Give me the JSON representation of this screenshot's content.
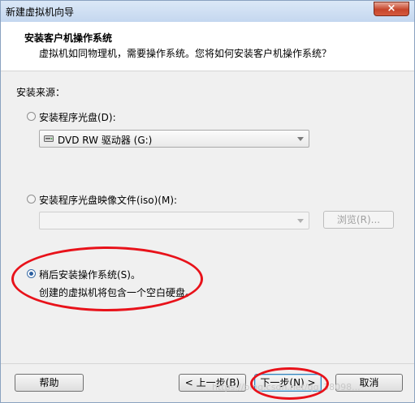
{
  "window": {
    "title": "新建虚拟机向导",
    "close_glyph": "×"
  },
  "header": {
    "title": "安装客户机操作系统",
    "subtitle": "虚拟机如同物理机，需要操作系统。您将如何安装客户机操作系统？"
  },
  "source_label": "安装来源：",
  "options": [
    {
      "label": "安装程序光盘(D):",
      "selected": false
    },
    {
      "label": "安装程序光盘映像文件(iso)(M):",
      "selected": false
    },
    {
      "label": "稍后安装操作系统(S)。",
      "selected": true
    }
  ],
  "drive_select": {
    "value": "DVD RW 驱动器 (G:)",
    "icon": "dvd-drive-icon"
  },
  "iso_select": {
    "value": ""
  },
  "browse_button": "浏览(R)...",
  "later_note": "创建的虚拟机将包含一个空白硬盘。",
  "buttons": {
    "help": "帮助",
    "back": "< 上一步(B)",
    "next": "下一步(N) >",
    "cancel": "取消"
  },
  "watermark": "https://blog.csdn.net/qq_38098...",
  "annotation_color": "#e8121a"
}
